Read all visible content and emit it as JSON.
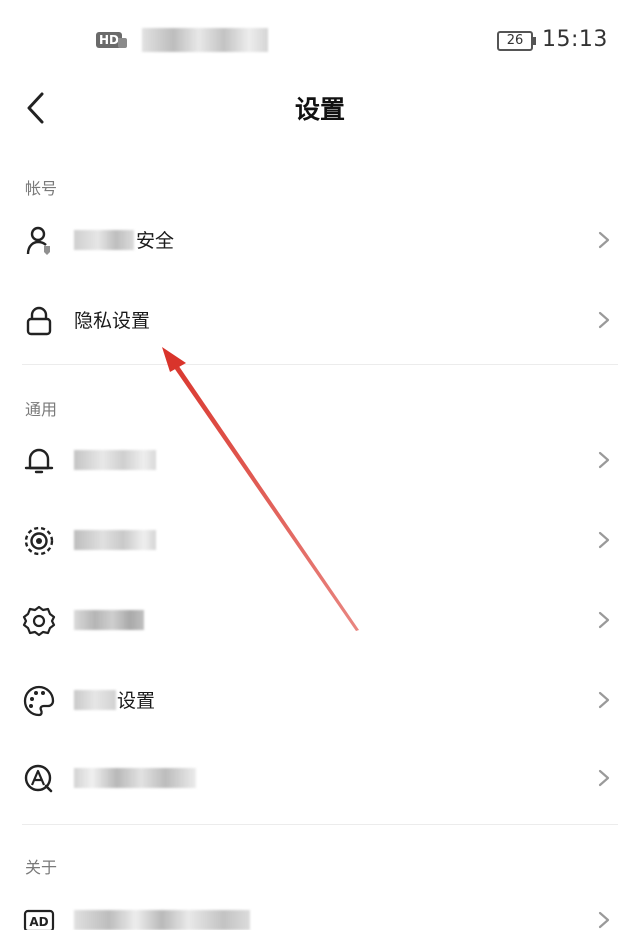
{
  "status_bar": {
    "hd_badge": "HD",
    "battery_level": "26",
    "time": "15:13"
  },
  "header": {
    "title": "设置"
  },
  "sections": {
    "account": {
      "title": "帐号",
      "items": [
        {
          "label": "安全",
          "icon": "user-shield-icon"
        },
        {
          "label": "隐私设置",
          "icon": "lock-icon"
        }
      ]
    },
    "general": {
      "title": "通用",
      "items": [
        {
          "label": "",
          "icon": "bell-icon"
        },
        {
          "label": "",
          "icon": "activity-target-icon"
        },
        {
          "label": "",
          "icon": "gear-icon"
        },
        {
          "label": "设置",
          "icon": "palette-icon"
        },
        {
          "label": "",
          "icon": "circle-a-icon"
        }
      ]
    },
    "about": {
      "title": "关于",
      "items": [
        {
          "label": "",
          "icon": "ad-icon"
        }
      ]
    }
  },
  "annotation": {
    "color": "#d9342b"
  },
  "colors": {
    "section_title": "#7a7a7a",
    "divider": "#ececec",
    "chevron": "#9a9a9a"
  }
}
